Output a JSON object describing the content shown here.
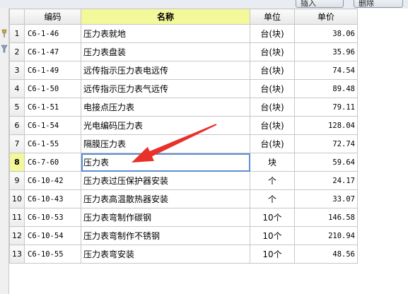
{
  "toolbar": {
    "btn1": "插入",
    "btn2": "删除"
  },
  "columns": {
    "rownum": "",
    "code": "编码",
    "name": "名称",
    "unit": "单位",
    "price": "单价"
  },
  "rows": [
    {
      "n": "1",
      "code": "C6-1-46",
      "name": "压力表就地",
      "unit": "台(块)",
      "price": "38.06"
    },
    {
      "n": "2",
      "code": "C6-1-47",
      "name": "压力表盘装",
      "unit": "台(块)",
      "price": "35.96"
    },
    {
      "n": "3",
      "code": "C6-1-49",
      "name": "远传指示压力表电远传",
      "unit": "台(块)",
      "price": "74.54"
    },
    {
      "n": "4",
      "code": "C6-1-50",
      "name": "远传指示压力表气远传",
      "unit": "台(块)",
      "price": "89.48"
    },
    {
      "n": "5",
      "code": "C6-1-51",
      "name": "电接点压力表",
      "unit": "台(块)",
      "price": "79.11"
    },
    {
      "n": "6",
      "code": "C6-1-54",
      "name": "光电编码压力表",
      "unit": "台(块)",
      "price": "128.04"
    },
    {
      "n": "7",
      "code": "C6-1-55",
      "name": "隔膜压力表",
      "unit": "台(块)",
      "price": "72.74"
    },
    {
      "n": "8",
      "code": "C6-7-60",
      "name": "压力表",
      "unit": "块",
      "price": "59.64"
    },
    {
      "n": "9",
      "code": "C6-10-42",
      "name": "压力表过压保护器安装",
      "unit": "个",
      "price": "24.17"
    },
    {
      "n": "10",
      "code": "C6-10-43",
      "name": "压力表高温散热器安装",
      "unit": "个",
      "price": "33.07"
    },
    {
      "n": "11",
      "code": "C6-10-53",
      "name": "压力表弯制作碳钢",
      "unit": "10个",
      "price": "146.58"
    },
    {
      "n": "12",
      "code": "C6-10-54",
      "name": "压力表弯制作不锈钢",
      "unit": "10个",
      "price": "210.94"
    },
    {
      "n": "13",
      "code": "C6-10-55",
      "name": "压力表弯安装",
      "unit": "10个",
      "price": "48.56"
    }
  ],
  "selected_row": 8,
  "colors": {
    "header_highlight": "#f3f89a",
    "selection": "#5a8fd6",
    "arrow": "#e8312a"
  }
}
